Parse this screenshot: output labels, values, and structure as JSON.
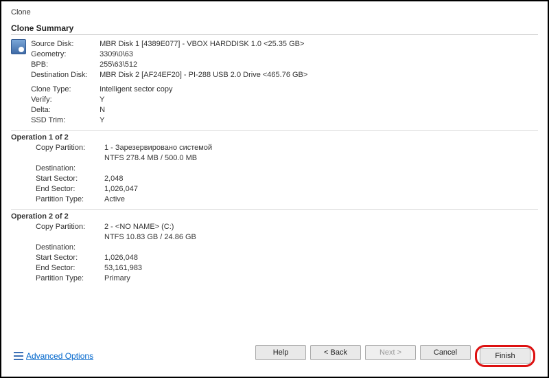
{
  "window": {
    "title": "Clone"
  },
  "heading": "Clone Summary",
  "summary": {
    "fields": [
      {
        "label": "Source Disk:",
        "value": "MBR Disk 1 [4389E077] - VBOX HARDDISK 1.0  <25.35 GB>"
      },
      {
        "label": "Geometry:",
        "value": "3309\\0\\63"
      },
      {
        "label": "BPB:",
        "value": "255\\63\\512"
      },
      {
        "label": "Destination Disk:",
        "value": "MBR Disk 2 [AF24EF20] - PI-288   USB 2.0 Drive  <465.76 GB>"
      }
    ],
    "fields2": [
      {
        "label": "Clone Type:",
        "value": "Intelligent sector copy"
      },
      {
        "label": "Verify:",
        "value": "Y"
      },
      {
        "label": "Delta:",
        "value": "N"
      },
      {
        "label": "SSD Trim:",
        "value": "Y"
      }
    ]
  },
  "operations": [
    {
      "heading": "Operation 1 of 2",
      "fields": [
        {
          "label": "Copy Partition:",
          "value": "1 - Зарезервировано системой"
        },
        {
          "label": "",
          "value": "NTFS 278.4 MB / 500.0 MB"
        },
        {
          "label": "Destination:",
          "value": ""
        },
        {
          "label": "Start Sector:",
          "value": "2,048"
        },
        {
          "label": "End Sector:",
          "value": "1,026,047"
        },
        {
          "label": "Partition Type:",
          "value": "Active"
        }
      ]
    },
    {
      "heading": "Operation 2 of 2",
      "fields": [
        {
          "label": "Copy Partition:",
          "value": "2 - <NO NAME> (C:)"
        },
        {
          "label": "",
          "value": "NTFS 10.83 GB / 24.86 GB"
        },
        {
          "label": "Destination:",
          "value": ""
        },
        {
          "label": "Start Sector:",
          "value": "1,026,048"
        },
        {
          "label": "End Sector:",
          "value": "53,161,983"
        },
        {
          "label": "Partition Type:",
          "value": "Primary"
        }
      ]
    }
  ],
  "footer": {
    "advanced_label": "Advanced Options",
    "buttons": {
      "help": "Help",
      "back": "< Back",
      "next": "Next >",
      "cancel": "Cancel",
      "finish": "Finish"
    }
  }
}
